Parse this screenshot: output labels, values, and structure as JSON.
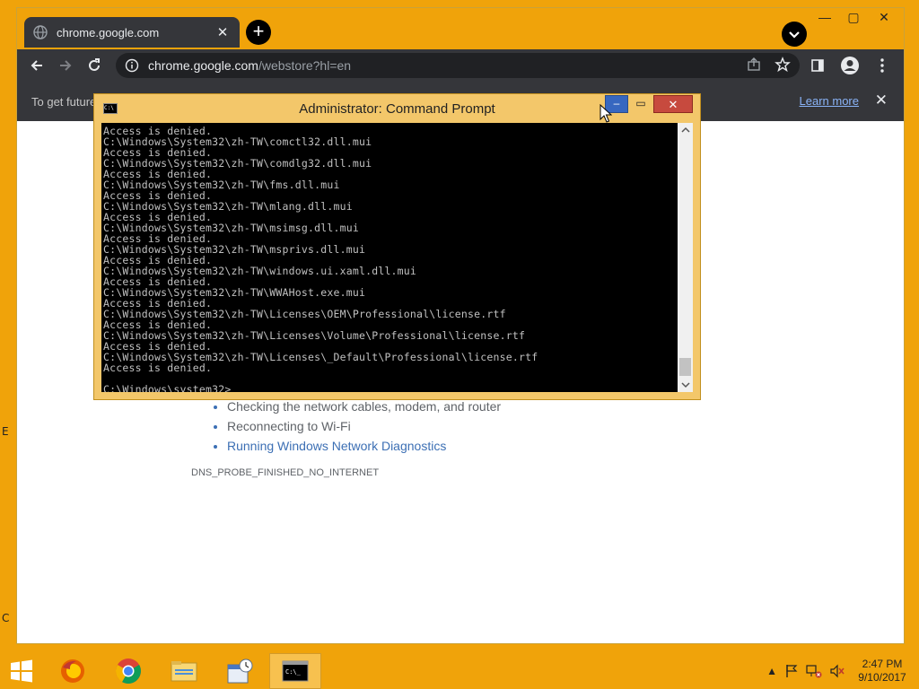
{
  "desktop": {
    "edge_glyphs": [
      "E",
      "C"
    ]
  },
  "chrome": {
    "tab": {
      "title": "chrome.google.com",
      "close": "✕"
    },
    "newtab": "+",
    "window_controls": {
      "minimize": "—",
      "maximize": "▢",
      "close": "✕"
    },
    "omnibox": {
      "host": "chrome.google.com",
      "path": "/webstore?hl=en"
    },
    "infobar": {
      "text": "To get future",
      "learn_more": "Learn more",
      "close": "✕"
    },
    "error": {
      "items": [
        "Checking the network cables, modem, and router",
        "Reconnecting to Wi-Fi",
        "Running Windows Network Diagnostics"
      ],
      "code": "DNS_PROBE_FINISHED_NO_INTERNET"
    }
  },
  "cmd": {
    "title": "Administrator: Command Prompt",
    "icon_text": "C:\\",
    "lines": [
      "Access is denied.",
      "C:\\Windows\\System32\\zh-TW\\comctl32.dll.mui",
      "Access is denied.",
      "C:\\Windows\\System32\\zh-TW\\comdlg32.dll.mui",
      "Access is denied.",
      "C:\\Windows\\System32\\zh-TW\\fms.dll.mui",
      "Access is denied.",
      "C:\\Windows\\System32\\zh-TW\\mlang.dll.mui",
      "Access is denied.",
      "C:\\Windows\\System32\\zh-TW\\msimsg.dll.mui",
      "Access is denied.",
      "C:\\Windows\\System32\\zh-TW\\msprivs.dll.mui",
      "Access is denied.",
      "C:\\Windows\\System32\\zh-TW\\windows.ui.xaml.dll.mui",
      "Access is denied.",
      "C:\\Windows\\System32\\zh-TW\\WWAHost.exe.mui",
      "Access is denied.",
      "C:\\Windows\\System32\\zh-TW\\Licenses\\OEM\\Professional\\license.rtf",
      "Access is denied.",
      "C:\\Windows\\System32\\zh-TW\\Licenses\\Volume\\Professional\\license.rtf",
      "Access is denied.",
      "C:\\Windows\\System32\\zh-TW\\Licenses\\_Default\\Professional\\license.rtf",
      "Access is denied.",
      ""
    ],
    "prompt": "C:\\Windows\\system32>",
    "controls": {
      "minimize": "‒",
      "maximize": "▭",
      "close": "✕"
    }
  },
  "taskbar": {
    "clock_time": "2:47 PM",
    "clock_date": "9/10/2017",
    "tray_arrow": "▲"
  },
  "colors": {
    "desktop": "#f0a30a",
    "chrome_dark": "#35363a",
    "link": "#3c6fb4",
    "cmd_frame": "#f3c76a"
  }
}
